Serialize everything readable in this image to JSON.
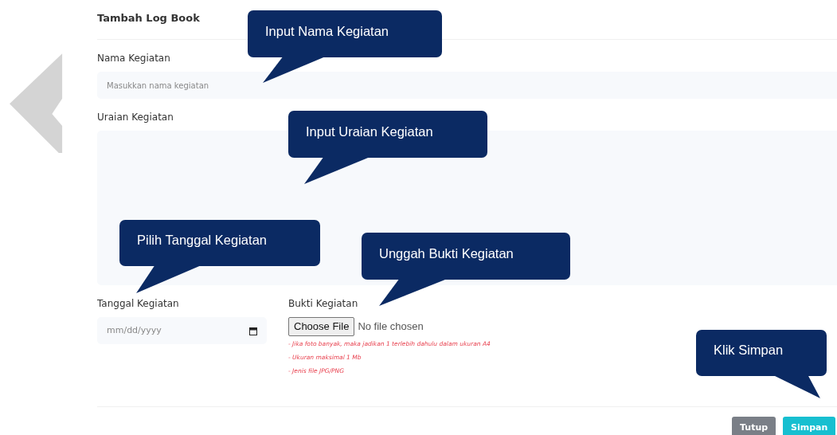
{
  "modal": {
    "title": "Tambah Log Book",
    "fields": [
      {
        "kind": "text",
        "label": "Nama Kegiatan",
        "placeholder": "Masukkan nama kegiatan"
      },
      {
        "kind": "textarea",
        "label": "Uraian Kegiatan"
      }
    ],
    "date_field": {
      "label": "Tanggal Kegiatan",
      "placeholder": "mm/dd/yyyy"
    },
    "file_field": {
      "label": "Bukti Kegiatan",
      "button": "Choose File",
      "status": "No file chosen",
      "hints": [
        "- Jika foto banyak, maka jadikan 1 terlebih dahulu dalam ukuran A4",
        "- Ukuran maksimal 1 Mb",
        "- Jenis file JPG/PNG"
      ]
    },
    "buttons": [
      {
        "label": "Tutup",
        "kind": "secondary"
      },
      {
        "label": "Simpan",
        "kind": "primary"
      }
    ]
  },
  "callouts": [
    {
      "text": "Input Nama Kegiatan"
    },
    {
      "text": "Input Uraian Kegiatan"
    },
    {
      "text": "Pilih Tanggal Kegiatan"
    },
    {
      "text": "Unggah Bukti Kegiatan"
    },
    {
      "text": "Klik Simpan"
    }
  ]
}
